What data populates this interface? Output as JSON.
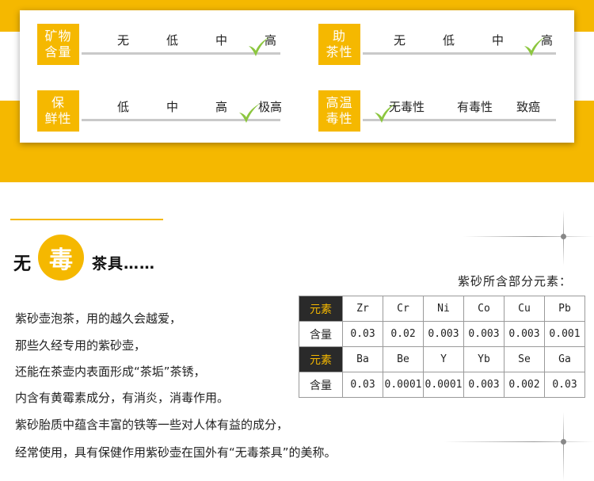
{
  "metrics": [
    {
      "id": "mineral",
      "label_line1": "矿物",
      "label_line2": "含量",
      "levels": [
        "无",
        "低",
        "中",
        "高"
      ],
      "selected": "高"
    },
    {
      "id": "tea",
      "label_line1": "助",
      "label_line2": "茶性",
      "levels": [
        "无",
        "低",
        "中",
        "高"
      ],
      "selected": "高"
    },
    {
      "id": "fresh",
      "label_line1": "保",
      "label_line2": "鲜性",
      "levels": [
        "低",
        "中",
        "高",
        "极高"
      ],
      "selected": "极高"
    },
    {
      "id": "toxic",
      "label_line1": "高温",
      "label_line2": "毒性",
      "levels": [
        "无毒性",
        "有毒性",
        "致癌"
      ],
      "selected": "无毒性"
    }
  ],
  "heading": {
    "prefix": "无",
    "highlight": "毒",
    "suffix": "茶具……"
  },
  "table": {
    "caption": "紫砂所含部分元素：",
    "row_label_element": "元素",
    "row_label_content": "含量",
    "group1": {
      "elements": [
        "Zr",
        "Cr",
        "Ni",
        "Co",
        "Cu",
        "Pb"
      ],
      "values": [
        "0.03",
        "0.02",
        "0.003",
        "0.003",
        "0.003",
        "0.001"
      ]
    },
    "group2": {
      "elements": [
        "Ba",
        "Be",
        "Y",
        "Yb",
        "Se",
        "Ga"
      ],
      "values": [
        "0.03",
        "0.0001",
        "0.0001",
        "0.003",
        "0.002",
        "0.03"
      ]
    }
  },
  "paragraph": [
    "紫砂壶泡茶，用的越久会越爱，",
    "那些久经专用的紫砂壶，",
    "还能在茶壶内表面形成“茶垢”茶锈，",
    "内含有黄霉素成分，有消炎，消毒作用。",
    "紫砂胎质中蕴含丰富的铁等一些对人体有益的成分，",
    "经常使用，具有保健作用紫砂壶在国外有“无毒茶具”的美称。"
  ],
  "colors": {
    "accent": "#f5b800",
    "check": "#8cc63f",
    "dark_cell": "#2a2a2a"
  },
  "icons": {
    "check": "checkmark-icon"
  }
}
